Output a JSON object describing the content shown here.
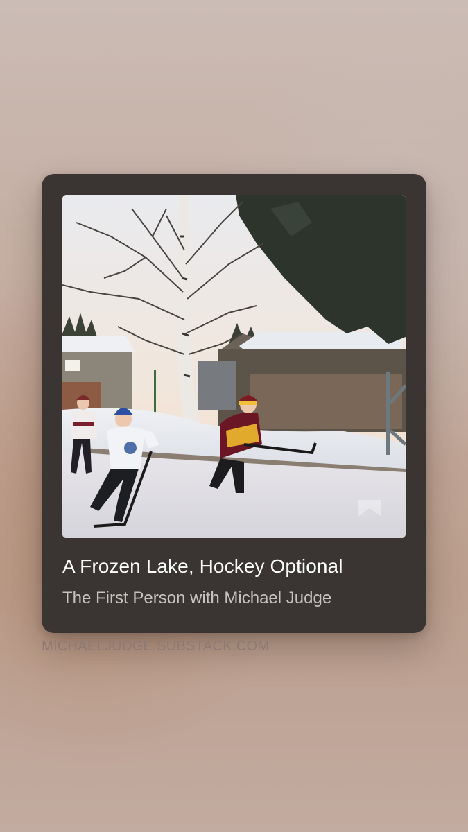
{
  "card": {
    "title": "A Frozen Lake, Hockey Optional",
    "publication": "The First Person with Michael Judge",
    "image": {
      "subject": "children-playing-backyard-ice-hockey",
      "icon": "bookmark-icon"
    }
  },
  "footer": {
    "domain": "MICHAELJUDGE.SUBSTACK.COM"
  },
  "colors": {
    "card_background": "#3a3532",
    "title_text": "#ffffff",
    "subtitle_text": "#c7c2bf",
    "domain_text": "#8e7a72"
  }
}
